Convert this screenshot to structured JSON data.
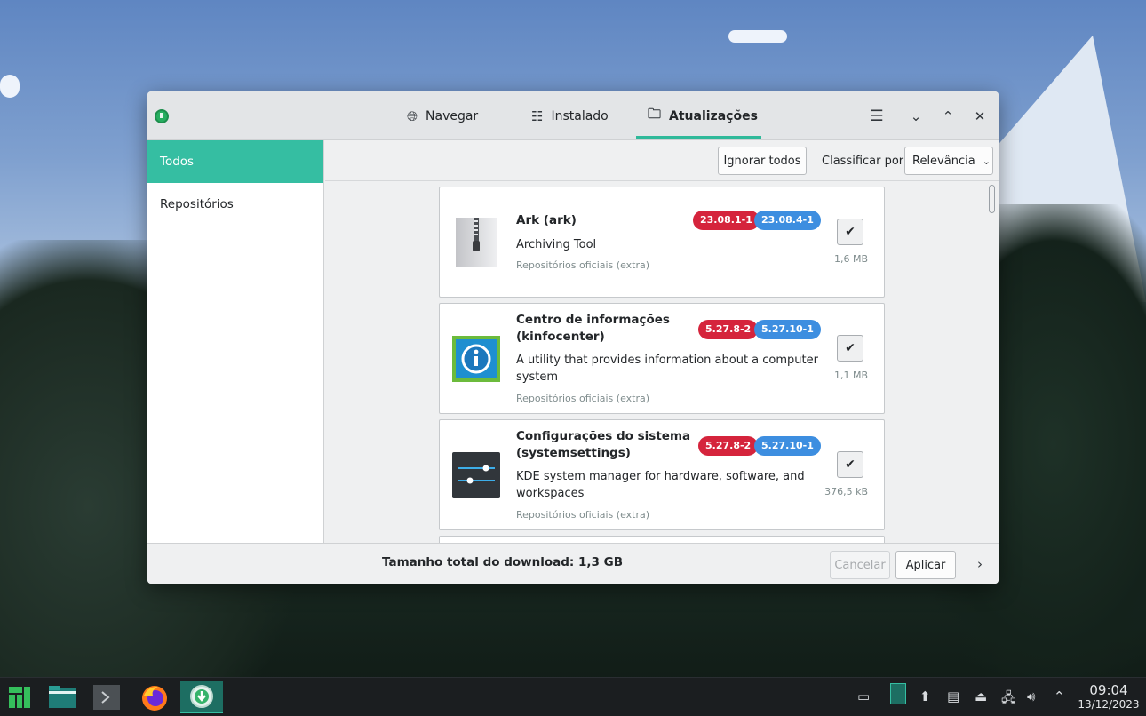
{
  "window": {
    "tabs": [
      {
        "label": "Navegar",
        "icon": "globe-icon"
      },
      {
        "label": "Instalado",
        "icon": "list-icon"
      },
      {
        "label": "Atualizações",
        "icon": "folder-update-icon"
      }
    ],
    "active_tab": "Atualizações",
    "accent_color": "#35bea2"
  },
  "sidebar": {
    "items": [
      {
        "label": "Todos",
        "active": true
      },
      {
        "label": "Repositórios",
        "active": false
      }
    ]
  },
  "toolbar": {
    "ignore_all": "Ignorar todos",
    "sort_label": "Classificar por",
    "sort_value": "Relevância"
  },
  "updates": [
    {
      "title": "Ark (ark)",
      "description": "Archiving Tool",
      "repo": "Repositórios oficiais (extra)",
      "old_version": "23.08.1-1",
      "new_version": "23.08.4-1",
      "size": "1,6 MB",
      "checked": true
    },
    {
      "title_line1": "Centro de informações",
      "title_line2": "(kinfocenter)",
      "description_line1": "A utility that provides information about a computer",
      "description_line2": "system",
      "repo": "Repositórios oficiais (extra)",
      "old_version": "5.27.8-2",
      "new_version": "5.27.10-1",
      "size": "1,1 MB",
      "checked": true
    },
    {
      "title_line1": "Configurações do sistema",
      "title_line2": "(systemsettings)",
      "description_line1": "KDE system manager for hardware, software, and",
      "description_line2": "workspaces",
      "repo": "Repositórios oficiais (extra)",
      "old_version": "5.27.8-2",
      "new_version": "5.27.10-1",
      "size": "376,5 kB",
      "checked": true
    }
  ],
  "footer": {
    "total": "Tamanho total do download: 1,3 GB",
    "cancel": "Cancelar",
    "apply": "Aplicar"
  },
  "taskbar": {
    "time": "09:04",
    "date": "13/12/2023"
  }
}
